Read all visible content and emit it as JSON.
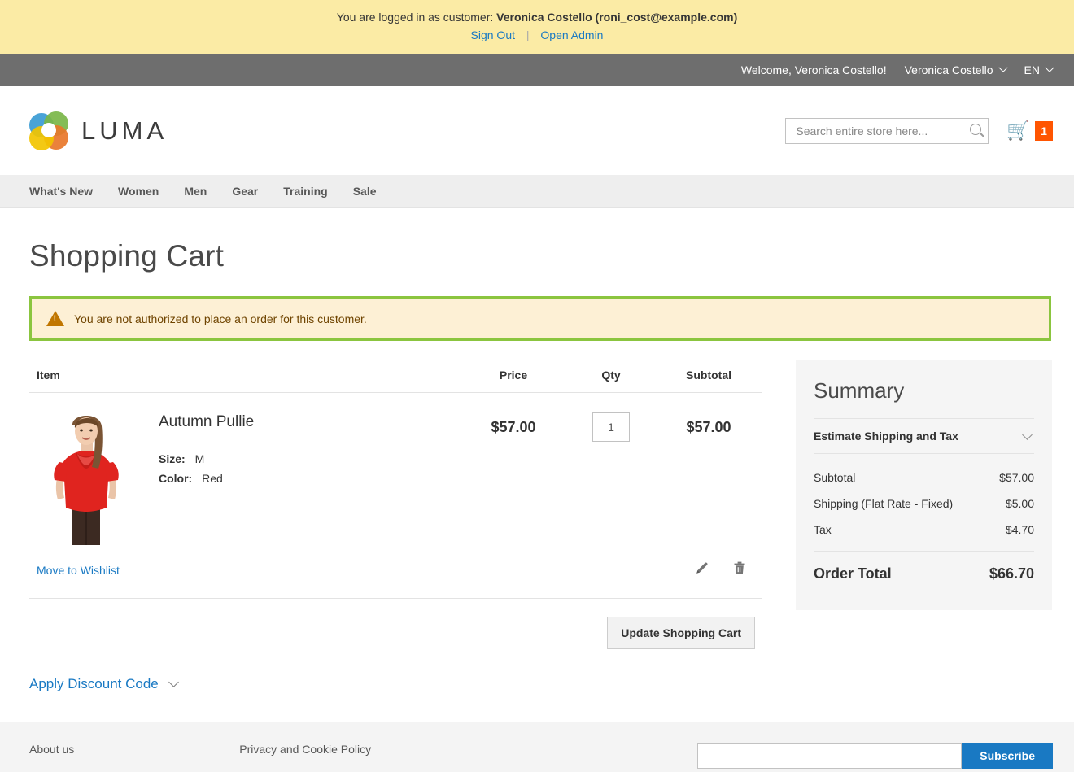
{
  "impersonation": {
    "prefix": "You are logged in as customer:",
    "customer": "Veronica Costello (roni_cost@example.com)",
    "sign_out": "Sign Out",
    "separator": "|",
    "open_admin": "Open Admin",
    "bg_color": "#fbeba5",
    "link_color": "#1979c3"
  },
  "panel_header": {
    "welcome": "Welcome, Veronica Costello!",
    "account_switcher": "Veronica Costello",
    "language_switcher": "EN",
    "bg_color": "#6e6e6e"
  },
  "header": {
    "logo_text": "LUMA",
    "search": {
      "placeholder": "Search entire store here...",
      "value": ""
    },
    "cart": {
      "count": "1",
      "badge_color": "#ff5501"
    }
  },
  "nav": {
    "items": [
      {
        "label": "What's New"
      },
      {
        "label": "Women"
      },
      {
        "label": "Men"
      },
      {
        "label": "Gear"
      },
      {
        "label": "Training"
      },
      {
        "label": "Sale"
      }
    ]
  },
  "page": {
    "title": "Shopping Cart"
  },
  "message": {
    "type": "warning",
    "text": "You are not authorized to place an order for this customer.",
    "bg_color": "#fdf0d5",
    "text_color": "#6f4400",
    "highlight_border_color": "#8bc53f"
  },
  "cart_table": {
    "headers": {
      "item": "Item",
      "price": "Price",
      "qty": "Qty",
      "subtotal": "Subtotal"
    },
    "rows": [
      {
        "name": "Autumn Pullie",
        "options": [
          {
            "label": "Size:",
            "value": "M"
          },
          {
            "label": "Color:",
            "value": "Red"
          }
        ],
        "price": "$57.00",
        "qty": "1",
        "subtotal": "$57.00",
        "wishlist_label": "Move to Wishlist"
      }
    ],
    "update_button": "Update Shopping Cart",
    "discount_label": "Apply Discount Code"
  },
  "summary": {
    "title": "Summary",
    "estimate_label": "Estimate Shipping and Tax",
    "lines": [
      {
        "label": "Subtotal",
        "value": "$57.00"
      },
      {
        "label": "Shipping (Flat Rate - Fixed)",
        "value": "$5.00"
      },
      {
        "label": "Tax",
        "value": "$4.70"
      }
    ],
    "order_total_label": "Order Total",
    "order_total_value": "$66.70"
  },
  "footer": {
    "link_about": "About us",
    "link_privacy": "Privacy and Cookie Policy",
    "newsletter_placeholder": "",
    "subscribe_label": "Subscribe"
  }
}
